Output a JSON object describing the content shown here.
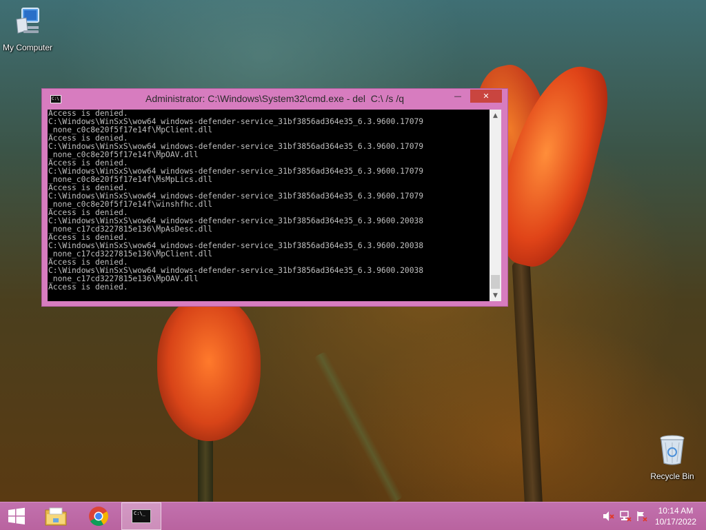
{
  "desktop": {
    "icons": [
      {
        "label": "My Computer"
      },
      {
        "label": "Recycle Bin"
      }
    ]
  },
  "cmd_window": {
    "title": "Administrator: C:\\Windows\\System32\\cmd.exe - del  C:\\ /s /q",
    "icon": "console-icon",
    "minimize_glyph": "—",
    "maximize_glyph": "☐",
    "close_glyph": "✕",
    "console_lines": [
      "Access is denied.",
      "C:\\Windows\\WinSxS\\wow64_windows-defender-service_31bf3856ad364e35_6.3.9600.17079",
      "_none_c0c8e20f5f17e14f\\MpClient.dll",
      "Access is denied.",
      "C:\\Windows\\WinSxS\\wow64_windows-defender-service_31bf3856ad364e35_6.3.9600.17079",
      "_none_c0c8e20f5f17e14f\\MpOAV.dll",
      "Access is denied.",
      "C:\\Windows\\WinSxS\\wow64_windows-defender-service_31bf3856ad364e35_6.3.9600.17079",
      "_none_c0c8e20f5f17e14f\\MsMpLics.dll",
      "Access is denied.",
      "C:\\Windows\\WinSxS\\wow64_windows-defender-service_31bf3856ad364e35_6.3.9600.17079",
      "_none_c0c8e20f5f17e14f\\winshfhc.dll",
      "Access is denied.",
      "C:\\Windows\\WinSxS\\wow64_windows-defender-service_31bf3856ad364e35_6.3.9600.20038",
      "_none_c17cd3227815e136\\MpAsDesc.dll",
      "Access is denied.",
      "C:\\Windows\\WinSxS\\wow64_windows-defender-service_31bf3856ad364e35_6.3.9600.20038",
      "_none_c17cd3227815e136\\MpClient.dll",
      "Access is denied.",
      "C:\\Windows\\WinSxS\\wow64_windows-defender-service_31bf3856ad364e35_6.3.9600.20038",
      "_none_c17cd3227815e136\\MpOAV.dll",
      "Access is denied."
    ],
    "scroll_up_glyph": "▲",
    "scroll_down_glyph": "▼"
  },
  "taskbar": {
    "start_icon": "windows-logo-icon",
    "pinned": [
      "file-explorer-icon",
      "chrome-icon",
      "command-prompt-icon"
    ],
    "cmd_task_glyph": "C:\\_",
    "tray": [
      "volume-muted-icon",
      "network-icon",
      "action-center-flag-icon"
    ],
    "time": "10:14 AM",
    "date": "10/17/2022"
  },
  "colors": {
    "window_frame": "#d77cbf",
    "close_button": "#c9453f",
    "taskbar": "#be6ca8",
    "console_bg": "#000000",
    "console_fg": "#c0c0c0"
  }
}
